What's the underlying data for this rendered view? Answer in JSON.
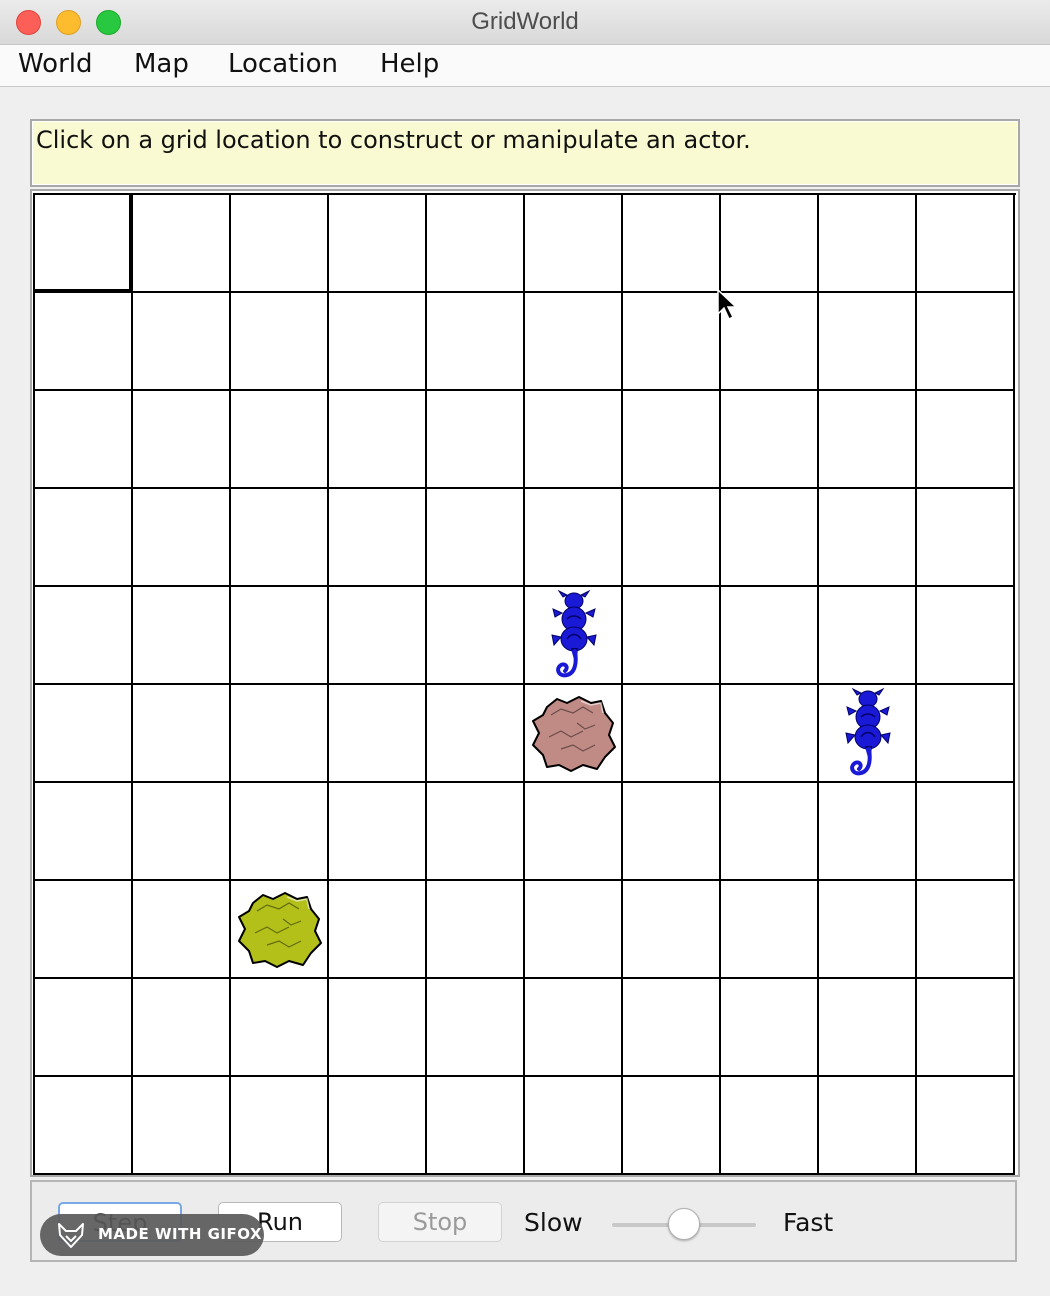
{
  "window": {
    "title": "GridWorld"
  },
  "menu": {
    "items": [
      {
        "label": "World"
      },
      {
        "label": "Map"
      },
      {
        "label": "Location"
      },
      {
        "label": "Help"
      }
    ]
  },
  "message": {
    "text": "Click on a grid location to construct or manipulate an actor."
  },
  "grid": {
    "rows": 10,
    "cols": 10,
    "selected": {
      "row": 0,
      "col": 0
    },
    "actors": [
      {
        "type": "critter",
        "row": 4,
        "col": 5,
        "color": "#1a1ad6"
      },
      {
        "type": "rock",
        "row": 5,
        "col": 5,
        "color": "#c08a85"
      },
      {
        "type": "critter",
        "row": 5,
        "col": 8,
        "color": "#1a1ad6"
      },
      {
        "type": "rock",
        "row": 7,
        "col": 2,
        "color": "#b3c01a"
      }
    ]
  },
  "controls": {
    "step_label": "Step",
    "run_label": "Run",
    "stop_label": "Stop",
    "slow_label": "Slow",
    "fast_label": "Fast",
    "speed_level": 0.5
  },
  "badge": {
    "text": "MADE WITH GIFOX"
  }
}
